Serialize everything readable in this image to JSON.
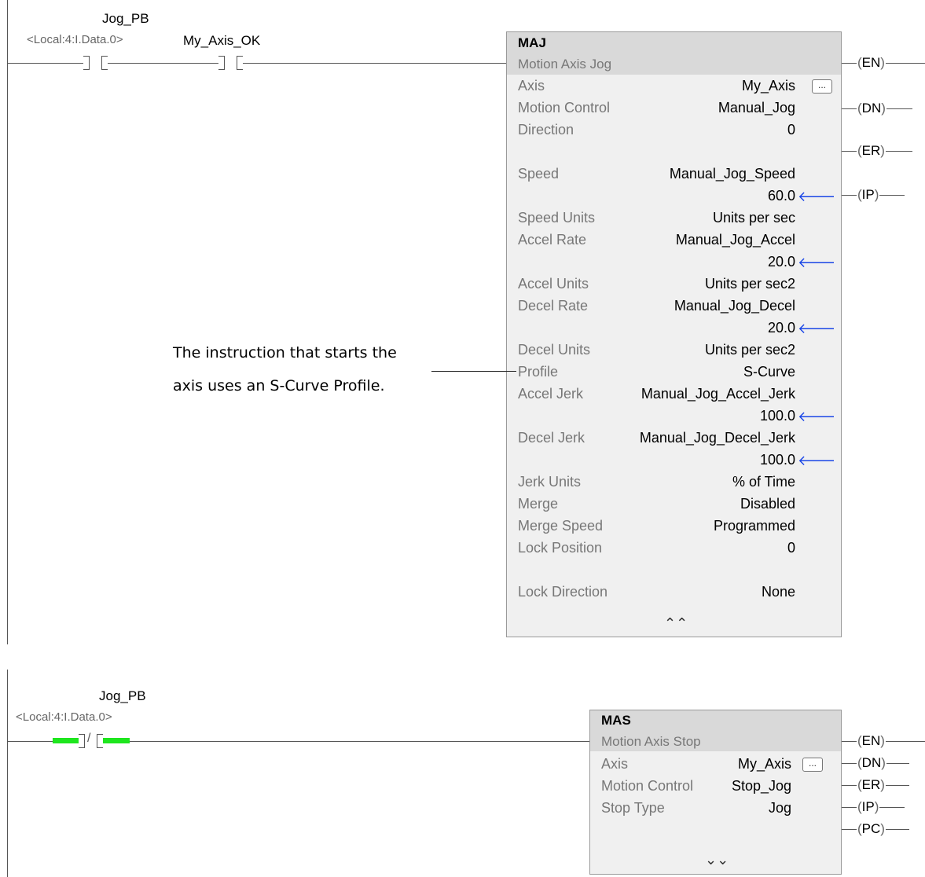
{
  "rung1": {
    "contact1": {
      "tag": "Jog_PB",
      "address": "<Local:4:I.Data.0>"
    },
    "contact2": {
      "tag": "My_Axis_OK"
    },
    "block": {
      "mnemonic": "MAJ",
      "name": "Motion Axis Jog",
      "params": [
        {
          "label": "Axis",
          "value": "My_Axis",
          "browse": true
        },
        {
          "label": "Motion Control",
          "value": "Manual_Jog"
        },
        {
          "label": "Direction",
          "value": "0"
        },
        {
          "label": "Speed",
          "value": "Manual_Jog_Speed",
          "live": "60.0"
        },
        {
          "label": "Speed Units",
          "value": "Units per sec"
        },
        {
          "label": "Accel Rate",
          "value": "Manual_Jog_Accel",
          "live": "20.0"
        },
        {
          "label": "Accel Units",
          "value": "Units per sec2"
        },
        {
          "label": "Decel Rate",
          "value": "Manual_Jog_Decel",
          "live": "20.0"
        },
        {
          "label": "Decel Units",
          "value": "Units per sec2"
        },
        {
          "label": "Profile",
          "value": "S-Curve"
        },
        {
          "label": "Accel Jerk",
          "value": "Manual_Jog_Accel_Jerk",
          "live": "100.0"
        },
        {
          "label": "Decel Jerk",
          "value": "Manual_Jog_Decel_Jerk",
          "live": "100.0"
        },
        {
          "label": "Jerk Units",
          "value": "% of Time"
        },
        {
          "label": "Merge",
          "value": "Disabled"
        },
        {
          "label": "Merge Speed",
          "value": "Programmed"
        },
        {
          "label": "Lock Position",
          "value": "0"
        },
        {
          "label": "Lock Direction",
          "value": "None"
        }
      ],
      "collapse_icon": "double-chevron-up-icon",
      "outputs": [
        "EN",
        "DN",
        "ER",
        "IP"
      ]
    },
    "note": {
      "line1": "The instruction that starts the",
      "line2": "axis uses an S-Curve Profile."
    }
  },
  "rung2": {
    "contact1": {
      "tag": "Jog_PB",
      "address": "<Local:4:I.Data.0>",
      "type": "normally-closed",
      "energized": true,
      "highlight_color": "#1ee61e"
    },
    "block": {
      "mnemonic": "MAS",
      "name": "Motion Axis Stop",
      "params": [
        {
          "label": "Axis",
          "value": "My_Axis",
          "browse": true
        },
        {
          "label": "Motion Control",
          "value": "Stop_Jog"
        },
        {
          "label": "Stop Type",
          "value": "Jog"
        }
      ],
      "expand_icon": "double-chevron-down-icon",
      "outputs": [
        "EN",
        "DN",
        "ER",
        "IP",
        "PC"
      ]
    }
  },
  "ui": {
    "browse_label": "...",
    "arrow_glyph": "🡐"
  }
}
